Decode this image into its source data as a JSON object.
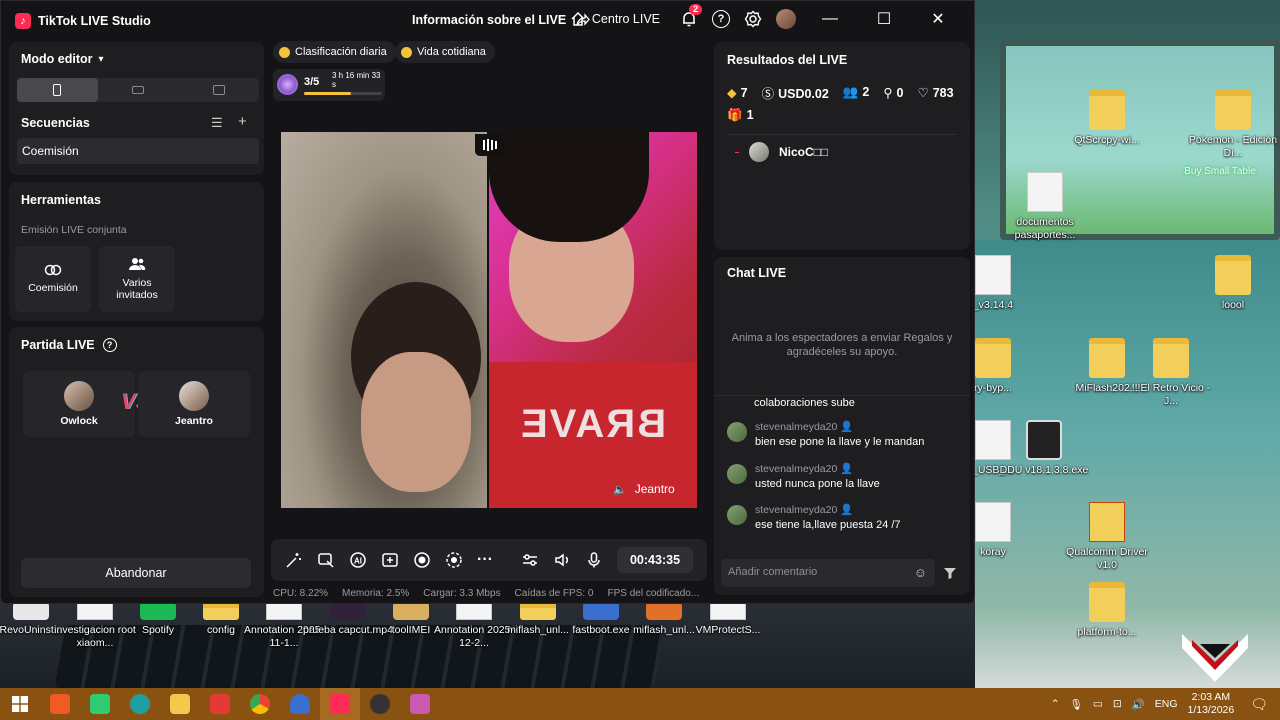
{
  "window": {
    "app_title": "TikTok LIVE Studio",
    "center_title": "Información sobre el LIVE",
    "centro_live_label": "Centro LIVE",
    "notification_count": "2"
  },
  "left": {
    "mode_editor_label": "Modo editor",
    "sequences_title": "Secuencias",
    "sequence_item": "Coemisión",
    "tools_title": "Herramientas",
    "joint_broadcast_label": "Emisión LIVE conjunta",
    "tool_coemision": "Coemisión",
    "tool_varios": "Varios invitados",
    "match_title": "Partida LIVE",
    "player_left": "Owlock",
    "player_right": "Jeantro",
    "vs_label": "VS",
    "abandon_label": "Abandonar"
  },
  "center": {
    "chip_ranking": "Clasificación diaria",
    "chip_daily": "Vida cotidiana",
    "progress_count": "3/5",
    "progress_time": "3 h 16 min 33 s",
    "progress_fraction": 0.6,
    "video_name": "Jeantro",
    "shirt_text": "BRAVE",
    "timer": "00:43:35",
    "stats": {
      "cpu": "CPU:  8.22%",
      "memory": "Memoria:  2.5%",
      "upload": "Cargar:  3.3 Mbps",
      "fps_drops": "Caídas de FPS:  0",
      "fps_enc": "FPS del codificado..."
    }
  },
  "right": {
    "results_title": "Resultados del LIVE",
    "diamonds": "7",
    "usd": "USD0.02",
    "viewers": "2",
    "new_followers": "0",
    "likes": "783",
    "gifts": "1",
    "viewer_name": "NicoC□□",
    "chat_title": "Chat LIVE",
    "chat_prompt": "Anima a los espectadores a enviar Regalos y agradéceles su apoyo.",
    "partial_msg": "colaboraciones sube",
    "messages": [
      {
        "user": "stevenalmeyda20",
        "text": "bien ese pone la llave y le mandan"
      },
      {
        "user": "stevenalmeyda20",
        "text": "usted nunca pone la llave"
      },
      {
        "user": "stevenalmeyda20",
        "text": "ese tiene la,llave puesta 24 /7"
      }
    ],
    "comment_placeholder": "Añadir comentario"
  },
  "desktop_icons": {
    "i1": "QtScrcpy-wi...",
    "i2": "Pokemon - Edición Di...",
    "i3": "documentos pasaportes...",
    "i4": "_v3.14.4",
    "i5": "loool",
    "i6": "ry-byp...",
    "i7": "MiFlash202...",
    "i8": "!!!El Retro Vicio - J...",
    "i9": "_USB_...",
    "i10": "DDU v18.1.3.8.exe",
    "i11": "koray",
    "i12": "Qualcomm Driver v1.0",
    "i13": "platform-to...",
    "i14": "RevoUninst...",
    "i15": "investigacion root xiaom...",
    "i16": "Spotify",
    "i17": "config",
    "i18": "Annotation 2025-11-1...",
    "i19": "prueba capcut.mp4",
    "i20": "toolIMEI",
    "i21": "Annotation 2025-12-2...",
    "i22": "miflash_unl...",
    "i23": "fastboot.exe",
    "i24": "miflash_unl...",
    "i25": "VMProtectS...",
    "buy_small_table": "Buy Small Table"
  },
  "taskbar": {
    "lang": "ENG",
    "time": "2:03 AM",
    "date": "1/13/2026"
  }
}
